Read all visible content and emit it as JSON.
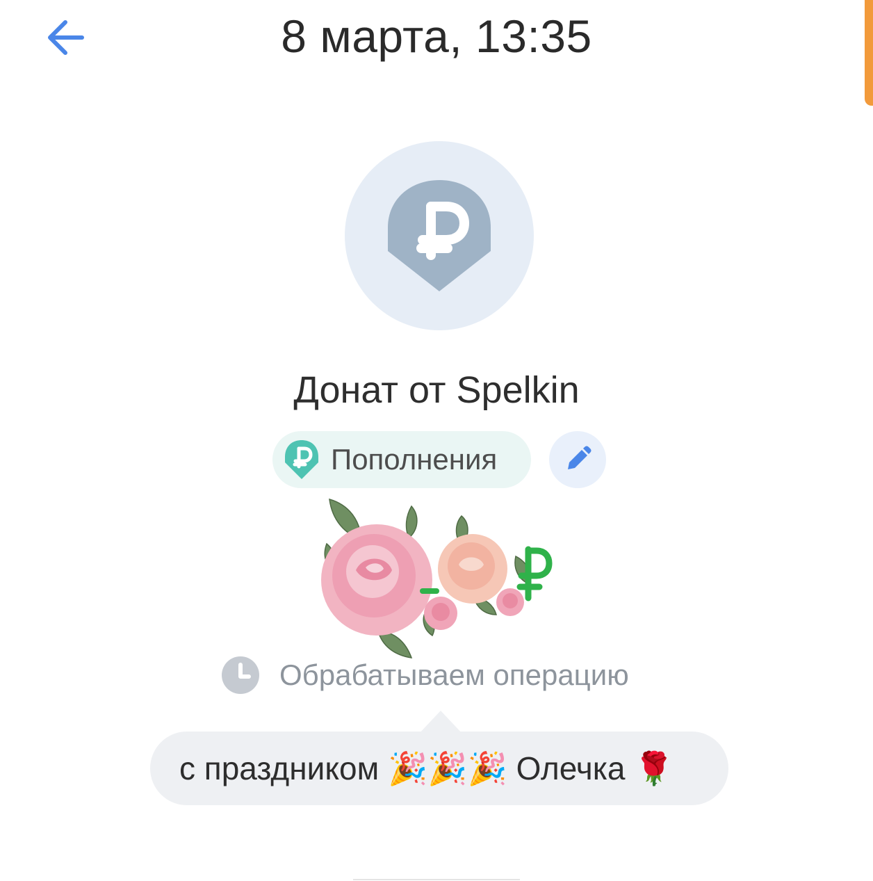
{
  "header": {
    "title": "8 марта, 13:35",
    "back_icon": "arrow-left-icon"
  },
  "operation": {
    "avatar_icon": "ruble-shield-icon",
    "title": "Донат от Spelkin"
  },
  "category": {
    "label": "Пополнения",
    "icon": "ruble-badge-icon",
    "edit_icon": "pencil-icon"
  },
  "sticker": {
    "name": "roses-sticker"
  },
  "status": {
    "icon": "clock-icon",
    "text": "Обрабатываем операцию"
  },
  "message": {
    "text": "с праздником 🎉🎉🎉 Олечка 🌹"
  },
  "colors": {
    "accent_blue": "#4a86e8",
    "avatar_bg": "#e6edf6",
    "avatar_icon": "#9fb3c6",
    "chip_bg": "#eaf6f4",
    "chip_icon": "#4ec3b2",
    "status_gray": "#8d949c",
    "bubble_bg": "#eef0f3"
  }
}
